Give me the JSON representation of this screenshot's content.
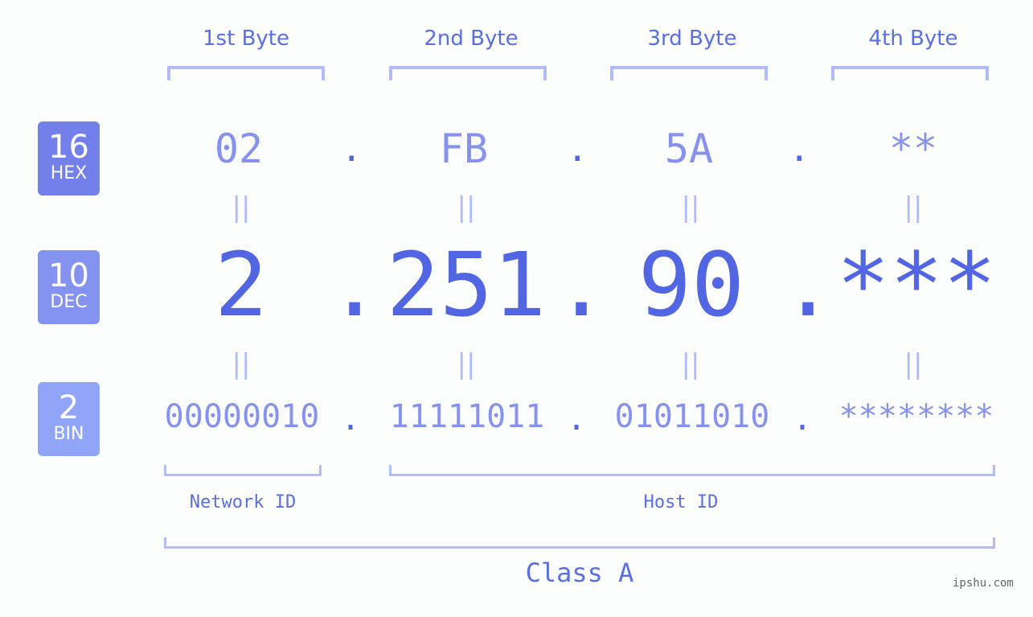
{
  "bytes": [
    {
      "label": "1st Byte",
      "hex": "02",
      "dec": "2",
      "bin": "00000010"
    },
    {
      "label": "2nd Byte",
      "hex": "FB",
      "dec": "251",
      "bin": "11111011"
    },
    {
      "label": "3rd Byte",
      "hex": "5A",
      "dec": "90",
      "bin": "01011010"
    },
    {
      "label": "4th Byte",
      "hex": "**",
      "dec": "***",
      "bin": "********"
    }
  ],
  "bases": [
    {
      "number": "16",
      "name": "HEX",
      "color": "#7380ea"
    },
    {
      "number": "10",
      "name": "DEC",
      "color": "#8593f0"
    },
    {
      "number": "2",
      "name": "BIN",
      "color": "#90a5f8"
    }
  ],
  "separator": ".",
  "equals": "||",
  "network_id_label": "Network ID",
  "host_id_label": "Host ID",
  "class_label": "Class A",
  "watermark": "ipshu.com",
  "colors": {
    "primary": "#5266e4",
    "light": "#8692ec",
    "bracket": "#b3bcfa"
  }
}
